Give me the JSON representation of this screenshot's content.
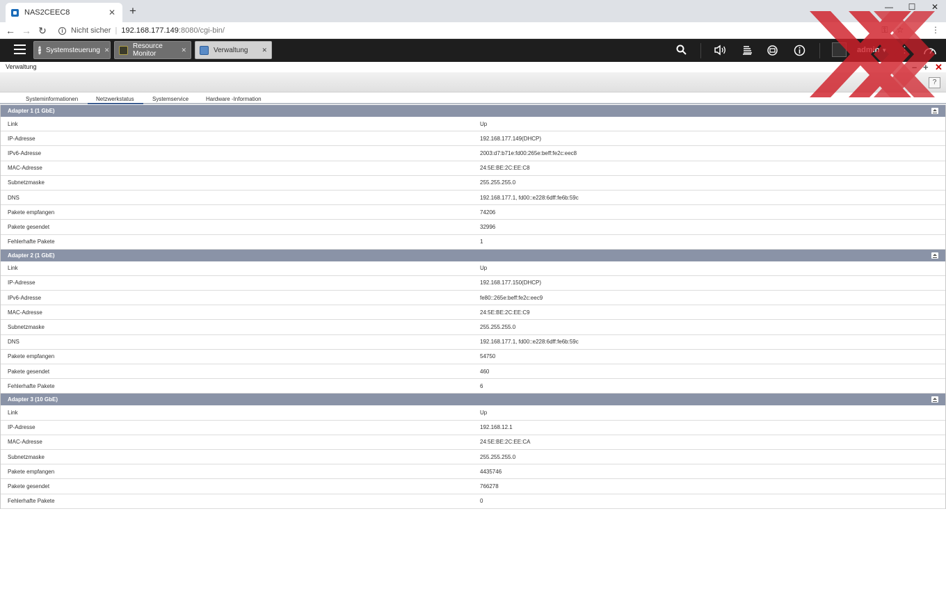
{
  "browser": {
    "tab_title": "NAS2CEEC8",
    "insecure_label": "Nicht sicher",
    "url_host": "192.168.177.149",
    "url_path": ":8080/cgi-bin/"
  },
  "qts": {
    "app_tabs": [
      {
        "label": "Systemsteuerung"
      },
      {
        "label": "Resource Monitor"
      },
      {
        "label": "Verwaltung"
      }
    ],
    "user": "admin"
  },
  "window": {
    "title": "Verwaltung"
  },
  "subtabs": [
    {
      "label": "Systeminformationen"
    },
    {
      "label": "Netzwerkstatus",
      "active": true
    },
    {
      "label": "Systemservice"
    },
    {
      "label": "Hardware -Information"
    }
  ],
  "adapters": [
    {
      "title": "Adapter 1 (1 GbE)",
      "rows": [
        {
          "k": "Link",
          "v": "Up"
        },
        {
          "k": "IP-Adresse",
          "v": "192.168.177.149(DHCP)"
        },
        {
          "k": "IPv6-Adresse",
          "v": "2003:d7:b71e:fd00:265e:beff:fe2c:eec8"
        },
        {
          "k": "MAC-Adresse",
          "v": "24:5E:BE:2C:EE:C8"
        },
        {
          "k": "Subnetzmaske",
          "v": "255.255.255.0"
        },
        {
          "k": "DNS",
          "v": "192.168.177.1, fd00::e228:6dff:fe6b:59c"
        },
        {
          "k": "Pakete empfangen",
          "v": "74206"
        },
        {
          "k": "Pakete gesendet",
          "v": "32996"
        },
        {
          "k": "Fehlerhafte Pakete",
          "v": "1"
        }
      ]
    },
    {
      "title": "Adapter 2 (1 GbE)",
      "rows": [
        {
          "k": "Link",
          "v": "Up"
        },
        {
          "k": "IP-Adresse",
          "v": "192.168.177.150(DHCP)"
        },
        {
          "k": "IPv6-Adresse",
          "v": "fe80::265e:beff:fe2c:eec9"
        },
        {
          "k": "MAC-Adresse",
          "v": "24:5E:BE:2C:EE:C9"
        },
        {
          "k": "Subnetzmaske",
          "v": "255.255.255.0"
        },
        {
          "k": "DNS",
          "v": "192.168.177.1, fd00::e228:6dff:fe6b:59c"
        },
        {
          "k": "Pakete empfangen",
          "v": "54750"
        },
        {
          "k": "Pakete gesendet",
          "v": "460"
        },
        {
          "k": "Fehlerhafte Pakete",
          "v": "6"
        }
      ]
    },
    {
      "title": "Adapter 3 (10 GbE)",
      "rows": [
        {
          "k": "Link",
          "v": "Up"
        },
        {
          "k": "IP-Adresse",
          "v": "192.168.12.1"
        },
        {
          "k": "MAC-Adresse",
          "v": "24:5E:BE:2C:EE:CA"
        },
        {
          "k": "Subnetzmaske",
          "v": "255.255.255.0"
        },
        {
          "k": "Pakete empfangen",
          "v": "4435746"
        },
        {
          "k": "Pakete gesendet",
          "v": "766278"
        },
        {
          "k": "Fehlerhafte Pakete",
          "v": "0"
        }
      ]
    }
  ],
  "colors": {
    "section_header": "#8a93a7",
    "topbar": "#1e1e1e",
    "watermark": "#d0202a"
  }
}
